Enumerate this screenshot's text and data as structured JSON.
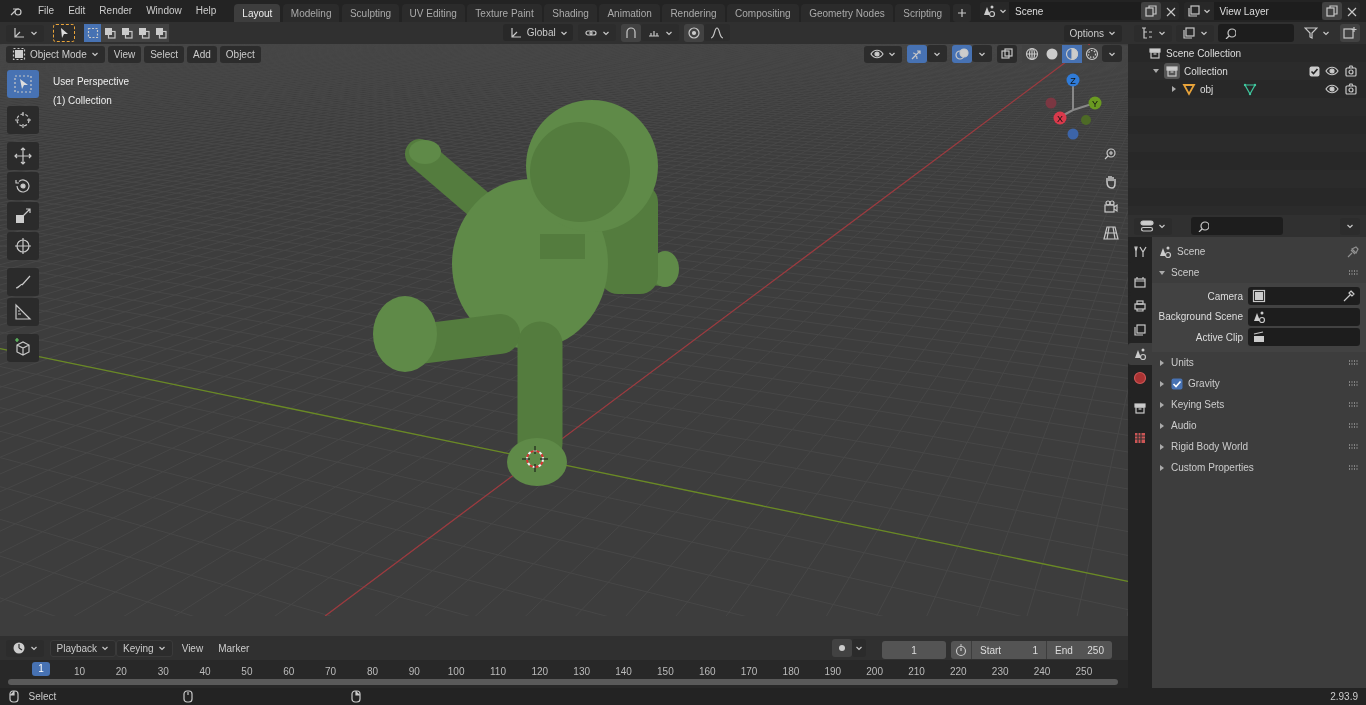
{
  "top_menu": [
    "File",
    "Edit",
    "Render",
    "Window",
    "Help"
  ],
  "workspaces": [
    {
      "label": "Layout",
      "selected": true
    },
    {
      "label": "Modeling",
      "selected": false
    },
    {
      "label": "Sculpting",
      "selected": false
    },
    {
      "label": "UV Editing",
      "selected": false
    },
    {
      "label": "Texture Paint",
      "selected": false
    },
    {
      "label": "Shading",
      "selected": false
    },
    {
      "label": "Animation",
      "selected": false
    },
    {
      "label": "Rendering",
      "selected": false
    },
    {
      "label": "Compositing",
      "selected": false
    },
    {
      "label": "Geometry Nodes",
      "selected": false
    },
    {
      "label": "Scripting",
      "selected": false
    }
  ],
  "scene_selector": {
    "value": "Scene"
  },
  "view_layer_selector": {
    "value": "View Layer"
  },
  "tool_settings": {
    "orientation": "Global",
    "options": "Options"
  },
  "viewport_header": {
    "mode": "Object Mode",
    "menus": [
      "View",
      "Select",
      "Add",
      "Object"
    ]
  },
  "shading_modes": [
    {
      "kind": "wireframe",
      "selected": false
    },
    {
      "kind": "solid",
      "selected": false
    },
    {
      "kind": "material",
      "selected": true
    },
    {
      "kind": "rendered",
      "selected": false
    }
  ],
  "tools": [
    {
      "kind": "select",
      "selected": true
    },
    {
      "kind": "cursor",
      "selected": false
    },
    {
      "kind": "move",
      "selected": false
    },
    {
      "kind": "rotate",
      "selected": false
    },
    {
      "kind": "scale",
      "selected": false
    },
    {
      "kind": "transform",
      "selected": false
    },
    {
      "kind": "annotate",
      "selected": false
    },
    {
      "kind": "measure",
      "selected": false
    },
    {
      "kind": "add-cube",
      "selected": false
    }
  ],
  "viewport": {
    "view_name": "User Perspective",
    "collection_name": "(1) Collection",
    "axes": [
      "Z",
      "Y",
      "X"
    ]
  },
  "outliner": {
    "root": "Scene Collection",
    "items": [
      {
        "label": "Collection",
        "expanded": true,
        "checked": true,
        "children": [
          {
            "label": "obj",
            "expanded": false
          }
        ]
      }
    ]
  },
  "properties": {
    "tabs": [
      {
        "kind": "tool",
        "selected": false
      },
      {
        "kind": "render",
        "selected": false
      },
      {
        "kind": "output",
        "selected": false
      },
      {
        "kind": "view-layer",
        "selected": false
      },
      {
        "kind": "scene",
        "selected": true
      },
      {
        "kind": "world",
        "selected": false
      },
      {
        "kind": "collection",
        "selected": false
      },
      {
        "kind": "texture",
        "selected": false
      }
    ],
    "context": "Scene",
    "panel": {
      "title": "Scene",
      "expanded": true,
      "fields": [
        {
          "label": "Camera",
          "kind": "camera"
        },
        {
          "label": "Background Scene",
          "kind": "scene"
        },
        {
          "label": "Active Clip",
          "kind": "clip"
        }
      ]
    },
    "sections": [
      {
        "label": "Units",
        "kind": "plain",
        "expanded": false
      },
      {
        "label": "Gravity",
        "kind": "checkbox",
        "checked": true,
        "expanded": false
      },
      {
        "label": "Keying Sets",
        "kind": "plain",
        "expanded": false
      },
      {
        "label": "Audio",
        "kind": "plain",
        "expanded": false
      },
      {
        "label": "Rigid Body World",
        "kind": "plain",
        "expanded": false
      },
      {
        "label": "Custom Properties",
        "kind": "plain",
        "expanded": false
      }
    ]
  },
  "timeline": {
    "dropdowns": [
      "Playback",
      "Keying"
    ],
    "menus": [
      "View",
      "Marker"
    ],
    "current_frame": "1",
    "start_label": "Start",
    "start": "1",
    "end_label": "End",
    "end": "250",
    "playhead": "1",
    "ruler_marks": [
      "10",
      "20",
      "30",
      "40",
      "50",
      "60",
      "70",
      "80",
      "90",
      "100",
      "110",
      "120",
      "130",
      "140",
      "150",
      "160",
      "170",
      "180",
      "190",
      "200",
      "210",
      "220",
      "230",
      "240",
      "250"
    ]
  },
  "status_bar": {
    "hint": "Select",
    "version": "2.93.9"
  }
}
